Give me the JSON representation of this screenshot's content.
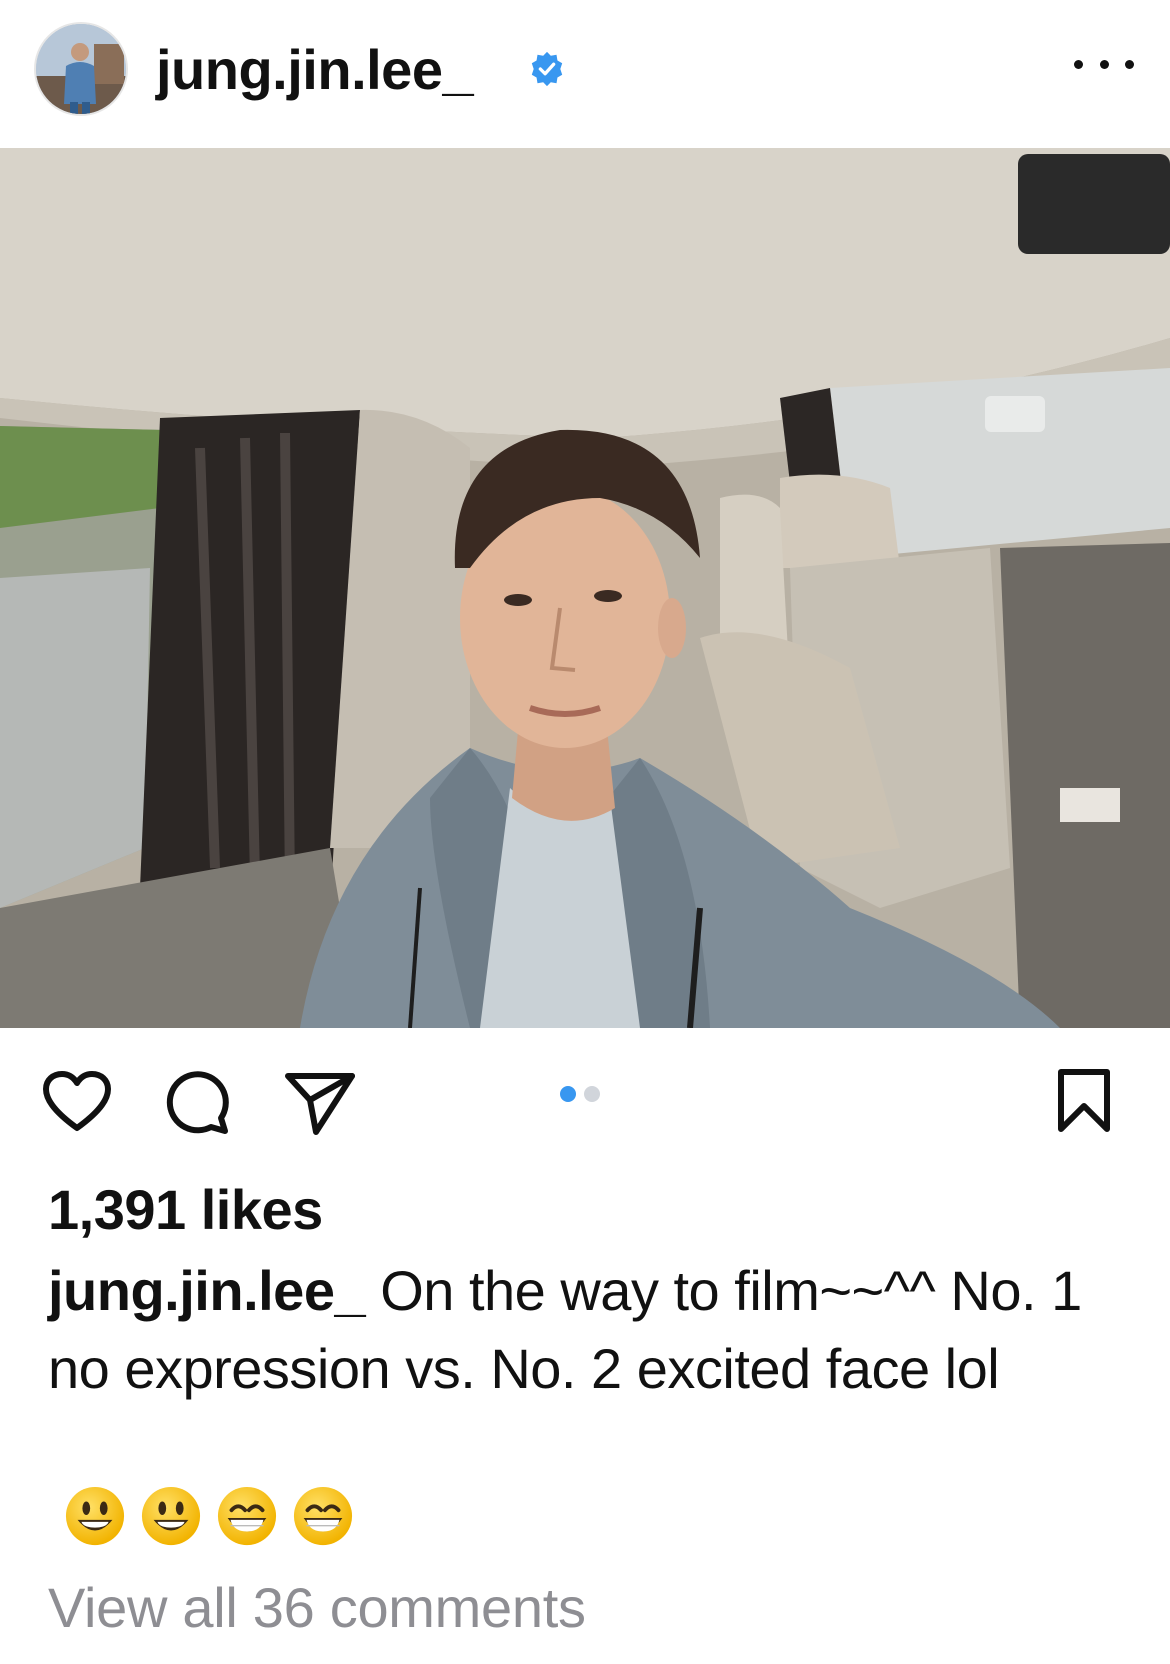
{
  "post": {
    "username": "jung.jin.lee_",
    "verified": true,
    "icons": {
      "avatar": "profile-photo",
      "verified": "verified-badge-icon",
      "more": "more-options-icon",
      "like": "heart-icon",
      "comment": "comment-bubble-icon",
      "share": "paper-plane-icon",
      "save": "bookmark-icon"
    },
    "carousel": {
      "total_images": 2,
      "current_index": 1
    },
    "likes_text": "1,391 likes",
    "caption": {
      "username": "jung.jin.lee_",
      "text": "On the way to film~~^^ No. 1 no expression vs. No. 2 excited face lol",
      "emojis": [
        "😃",
        "😃",
        "😁",
        "😁"
      ]
    },
    "view_comments_text": "View all 36 comments"
  },
  "colors": {
    "accent_blue": "#3897f0",
    "text_primary": "#111111",
    "text_secondary": "#8e8e93",
    "dot_inactive": "#d1d5db"
  }
}
